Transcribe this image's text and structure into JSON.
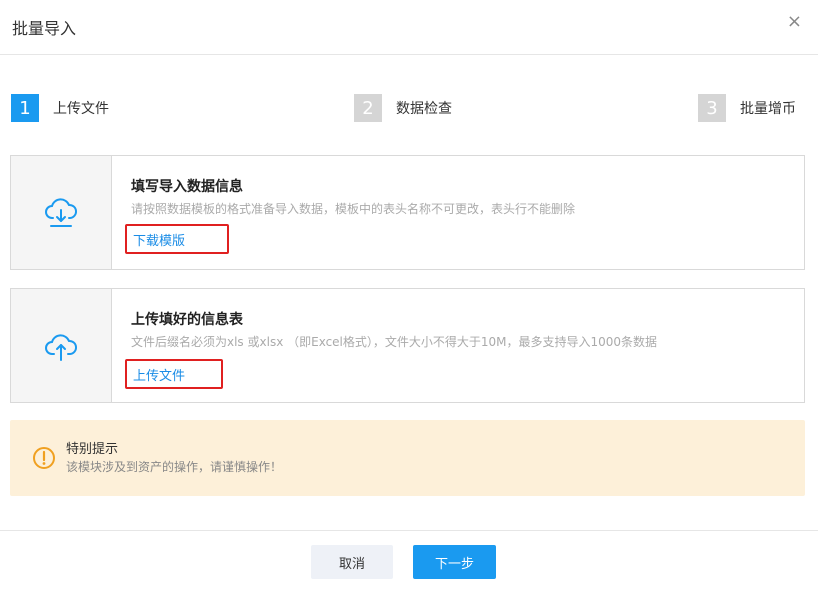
{
  "dialog": {
    "title": "批量导入",
    "close_glyph": "×"
  },
  "steps": [
    {
      "number": "1",
      "label": "上传文件",
      "active": true
    },
    {
      "number": "2",
      "label": "数据检查",
      "active": false
    },
    {
      "number": "3",
      "label": "批量增币",
      "active": false
    }
  ],
  "cards": [
    {
      "icon": "cloud-download-icon",
      "title": "填写导入数据信息",
      "description": "请按照数据模板的格式准备导入数据，模板中的表头名称不可更改，表头行不能删除",
      "link": "下载模版"
    },
    {
      "icon": "cloud-upload-icon",
      "title": "上传填好的信息表",
      "description": "文件后缀名必须为xls 或xlsx （即Excel格式），文件大小不得大于10M，最多支持导入1000条数据",
      "link": "上传文件"
    }
  ],
  "notice": {
    "icon": "warning-circle-icon",
    "title": "特别提示",
    "text": "该模块涉及到资产的操作，请谨慎操作！"
  },
  "footer": {
    "cancel_label": "取消",
    "next_label": "下一步"
  },
  "colors": {
    "primary": "#1a9af0",
    "link": "#1a8ce6",
    "highlight_border": "#e02020",
    "notice_bg": "#fdf0d9",
    "notice_icon": "#f0a020"
  }
}
